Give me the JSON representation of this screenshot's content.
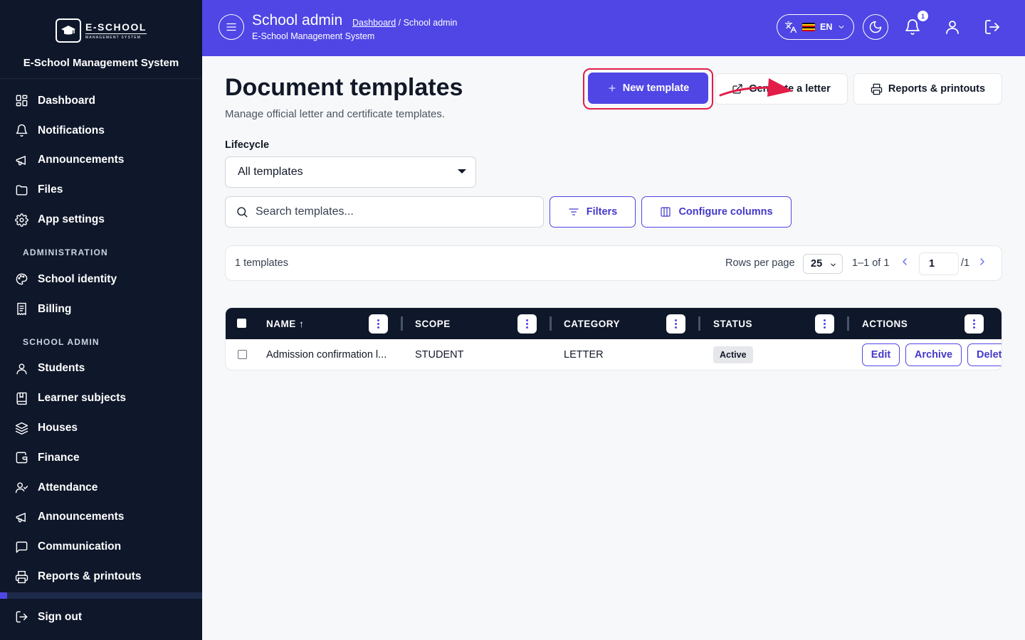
{
  "brand": {
    "logo_main": "E-SCHOOL",
    "logo_sub": "MANAGEMENT SYSTEM",
    "title": "E-School Management System"
  },
  "sidebar": {
    "items": [
      {
        "label": "Dashboard",
        "icon": "dashboard-icon"
      },
      {
        "label": "Notifications",
        "icon": "bell-icon"
      },
      {
        "label": "Announcements",
        "icon": "megaphone-icon"
      },
      {
        "label": "Files",
        "icon": "folder-icon"
      },
      {
        "label": "App settings",
        "icon": "gear-icon"
      }
    ],
    "section_admin": "ADMINISTRATION",
    "admin_items": [
      {
        "label": "School identity",
        "icon": "palette-icon"
      },
      {
        "label": "Billing",
        "icon": "receipt-icon"
      }
    ],
    "section_school": "SCHOOL ADMIN",
    "school_items": [
      {
        "label": "Students",
        "icon": "user-icon"
      },
      {
        "label": "Learner subjects",
        "icon": "book-icon"
      },
      {
        "label": "Houses",
        "icon": "layers-icon"
      },
      {
        "label": "Finance",
        "icon": "wallet-icon"
      },
      {
        "label": "Attendance",
        "icon": "user-check-icon"
      },
      {
        "label": "Announcements",
        "icon": "megaphone-icon"
      },
      {
        "label": "Communication",
        "icon": "chat-icon"
      },
      {
        "label": "Reports & printouts",
        "icon": "printer-icon"
      }
    ],
    "signout": "Sign out"
  },
  "header": {
    "title": "School admin",
    "breadcrumb_link": "Dashboard",
    "breadcrumb_current": " / School admin",
    "subtitle": "E-School Management System",
    "language": "EN",
    "notification_count": "1",
    "colors": {
      "primary": "#4f46e5",
      "sidebar": "#0f172a",
      "highlight": "#e11d48"
    }
  },
  "main": {
    "title": "Document templates",
    "subtitle": "Manage official letter and certificate templates.",
    "new_template": "New template",
    "generate_letter": "Generate a letter",
    "reports": "Reports & printouts",
    "lifecycle_label": "Lifecycle",
    "lifecycle_value": "All templates",
    "search_placeholder": "Search templates...",
    "filters": "Filters",
    "configure_columns": "Configure columns"
  },
  "pager": {
    "count": "1 templates",
    "rows_per_page_label": "Rows per page",
    "rows_per_page": "25",
    "range": "1–1 of 1",
    "page": "1",
    "total_pages": "/1"
  },
  "table": {
    "columns": [
      "NAME ↑",
      "SCOPE",
      "CATEGORY",
      "STATUS",
      "ACTIONS"
    ],
    "rows": [
      {
        "name": "Admission confirmation l...",
        "scope": "STUDENT",
        "category": "LETTER",
        "status": "Active",
        "actions": [
          "Edit",
          "Archive",
          "Delet"
        ]
      }
    ]
  }
}
